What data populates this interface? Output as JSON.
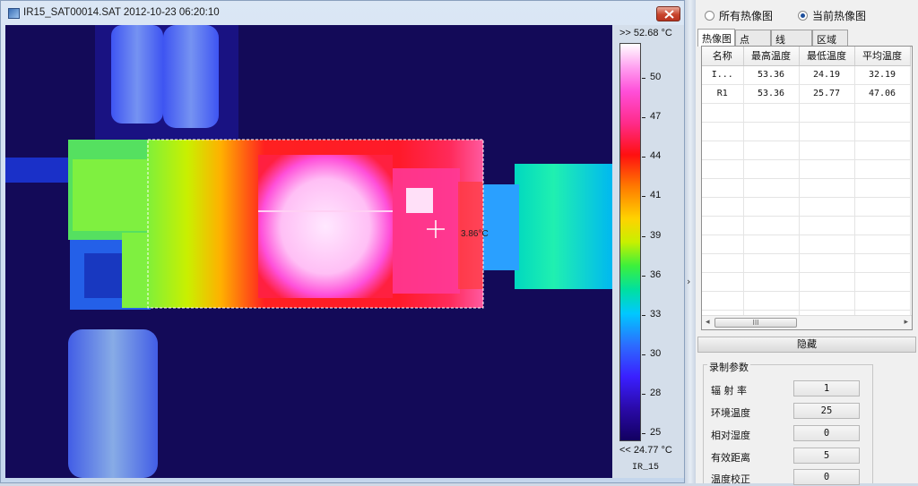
{
  "window": {
    "title": "IR15_SAT00014.SAT 2012-10-23 06:20:10"
  },
  "thermal": {
    "spot_label": "3.86°C"
  },
  "scale": {
    "max_label": ">> 52.68 °C",
    "min_label": "<< 24.77 °C",
    "ticks": [
      "50",
      "47",
      "44",
      "41",
      "39",
      "36",
      "33",
      "30",
      "28",
      "25"
    ],
    "name": "IR_15",
    "colors": [
      "#ffffff",
      "#ff4fd9",
      "#ff1010",
      "#ffd200",
      "#3cf03c",
      "#00c8ff",
      "#3a1fff",
      "#120060"
    ]
  },
  "view_mode": {
    "all_label": "所有热像图",
    "current_label": "当前热像图",
    "selected": "current"
  },
  "tabs": [
    "热像图",
    "点",
    "线",
    "区域"
  ],
  "grid": {
    "headers": [
      "名称",
      "最高温度",
      "最低温度",
      "平均温度"
    ],
    "rows": [
      [
        "I...",
        "53.36",
        "24.19",
        "32.19"
      ],
      [
        "R1",
        "53.36",
        "25.77",
        "47.06"
      ]
    ],
    "scroll_thumb": "III"
  },
  "hide_label": "隐藏",
  "params": {
    "title": "录制参数",
    "items": [
      {
        "label": "辐 射 率",
        "value": "1"
      },
      {
        "label": "环境温度",
        "value": "25"
      },
      {
        "label": "相对湿度",
        "value": "0"
      },
      {
        "label": "有效距离",
        "value": "5"
      },
      {
        "label": "温度校正",
        "value": "0"
      }
    ]
  }
}
